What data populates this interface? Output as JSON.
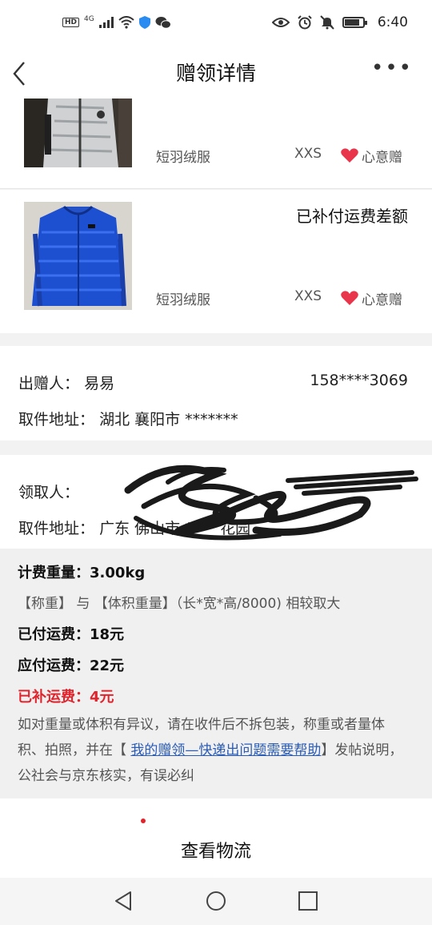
{
  "status_bar": {
    "hd": "HD",
    "net": "4G",
    "time": "6:40",
    "icons": [
      "signal-icon",
      "wifi-icon",
      "shield-icon",
      "wechat-icon",
      "eye-icon",
      "alarm-icon",
      "mute-icon",
      "battery-icon"
    ]
  },
  "header": {
    "title": "赠领详情"
  },
  "products": [
    {
      "name": "短羽绒服",
      "size": "XXS",
      "tag": "心意赠",
      "status": ""
    },
    {
      "name": "短羽绒服",
      "size": "XXS",
      "tag": "心意赠",
      "status": "已补付运费差额"
    }
  ],
  "giver": {
    "label": "出赠人：",
    "name": "易易",
    "phone": "158****3069",
    "address_label": "取件地址：",
    "address": "湖北 襄阳市 *******"
  },
  "receiver": {
    "label": "领取人：",
    "address_label": "取件地址：",
    "address": "广东 佛山市 **** 花园"
  },
  "fees": {
    "weight": "计费重量：3.00kg",
    "rule": "【称重】 与 【体积重量】（长*宽*高/8000) 相较取大",
    "paid": "已付运费：18元",
    "due": "应付运费：22元",
    "supplement": "已补运费：4元",
    "note_before": "如对重量或体积有异议，请在收件后不拆包装，称重或者量体积、拍照，并在【 ",
    "note_link": "我的赠领—快递出问题需要帮助",
    "note_after": "】发帖说明，公社会与京东核实，有误必纠"
  },
  "actions": {
    "logistics": "查看物流"
  },
  "colors": {
    "accent_red": "#e0242d",
    "link_blue": "#2a5bb5",
    "heart": "#e8354b"
  }
}
